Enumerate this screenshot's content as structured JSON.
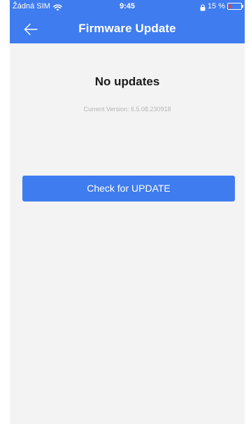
{
  "status_bar": {
    "carrier": "Žádná SIM",
    "time": "9:45",
    "battery_text": "15 %",
    "battery_level_percent": 15,
    "icons": [
      "wifi-icon",
      "lock-icon",
      "battery-icon"
    ]
  },
  "header": {
    "back_icon": "arrow-left-icon",
    "title": "Firmware Update"
  },
  "main": {
    "status_title": "No updates",
    "version_line": "Current Version:  6.5.08.230918",
    "check_button_label": "Check for UPDATE"
  },
  "colors": {
    "accent": "#3f7cf0",
    "background": "#f3f3f3",
    "title_text": "#1a1a1a",
    "muted_text": "#b5b5b5",
    "battery_low": "#ff3b30"
  }
}
